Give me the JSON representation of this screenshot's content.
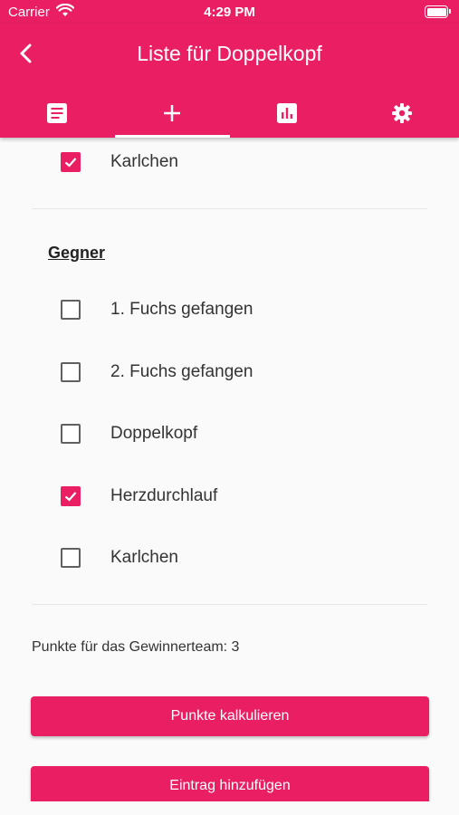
{
  "status_bar": {
    "carrier": "Carrier",
    "time": "4:29 PM"
  },
  "header": {
    "title": "Liste für Doppelkopf",
    "tabs": [
      {
        "icon": "list-icon",
        "active": false
      },
      {
        "icon": "plus-icon",
        "active": true
      },
      {
        "icon": "bar-chart-icon",
        "active": false
      },
      {
        "icon": "gear-icon",
        "active": false
      }
    ]
  },
  "colors": {
    "accent": "#e91e63",
    "background": "#fafafa"
  },
  "top_item": {
    "label": "Karlchen",
    "checked": true
  },
  "opponents": {
    "title": "Gegner",
    "items": [
      {
        "label": "1. Fuchs gefangen",
        "checked": false
      },
      {
        "label": "2. Fuchs gefangen",
        "checked": false
      },
      {
        "label": "Doppelkopf",
        "checked": false
      },
      {
        "label": "Herzdurchlauf",
        "checked": true
      },
      {
        "label": "Karlchen",
        "checked": false
      }
    ]
  },
  "points_text": "Punkte für das Gewinnerteam: 3",
  "buttons": {
    "calculate": "Punkte kalkulieren",
    "add_entry": "Eintrag hinzufügen"
  }
}
